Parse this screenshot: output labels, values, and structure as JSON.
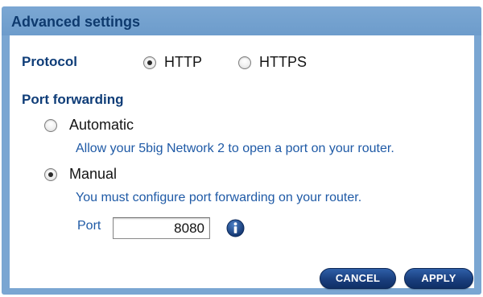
{
  "dialog": {
    "title": "Advanced settings"
  },
  "protocol": {
    "label": "Protocol",
    "options": [
      {
        "label": "HTTP",
        "selected": true
      },
      {
        "label": "HTTPS",
        "selected": false
      }
    ]
  },
  "port_forwarding": {
    "label": "Port forwarding",
    "options": [
      {
        "label": "Automatic",
        "selected": false,
        "description": "Allow your 5big Network 2 to open a port on your router."
      },
      {
        "label": "Manual",
        "selected": true,
        "description": "You must configure port forwarding on your router."
      }
    ],
    "port": {
      "label": "Port",
      "value": "8080"
    }
  },
  "buttons": {
    "cancel": "CANCEL",
    "apply": "APPLY"
  },
  "colors": {
    "header_bg": "#7aa6d2",
    "heading_text": "#0f3d78",
    "description_text": "#1f5aa6",
    "button_bg": "#183c7a"
  },
  "icons": {
    "info": "info-icon"
  }
}
